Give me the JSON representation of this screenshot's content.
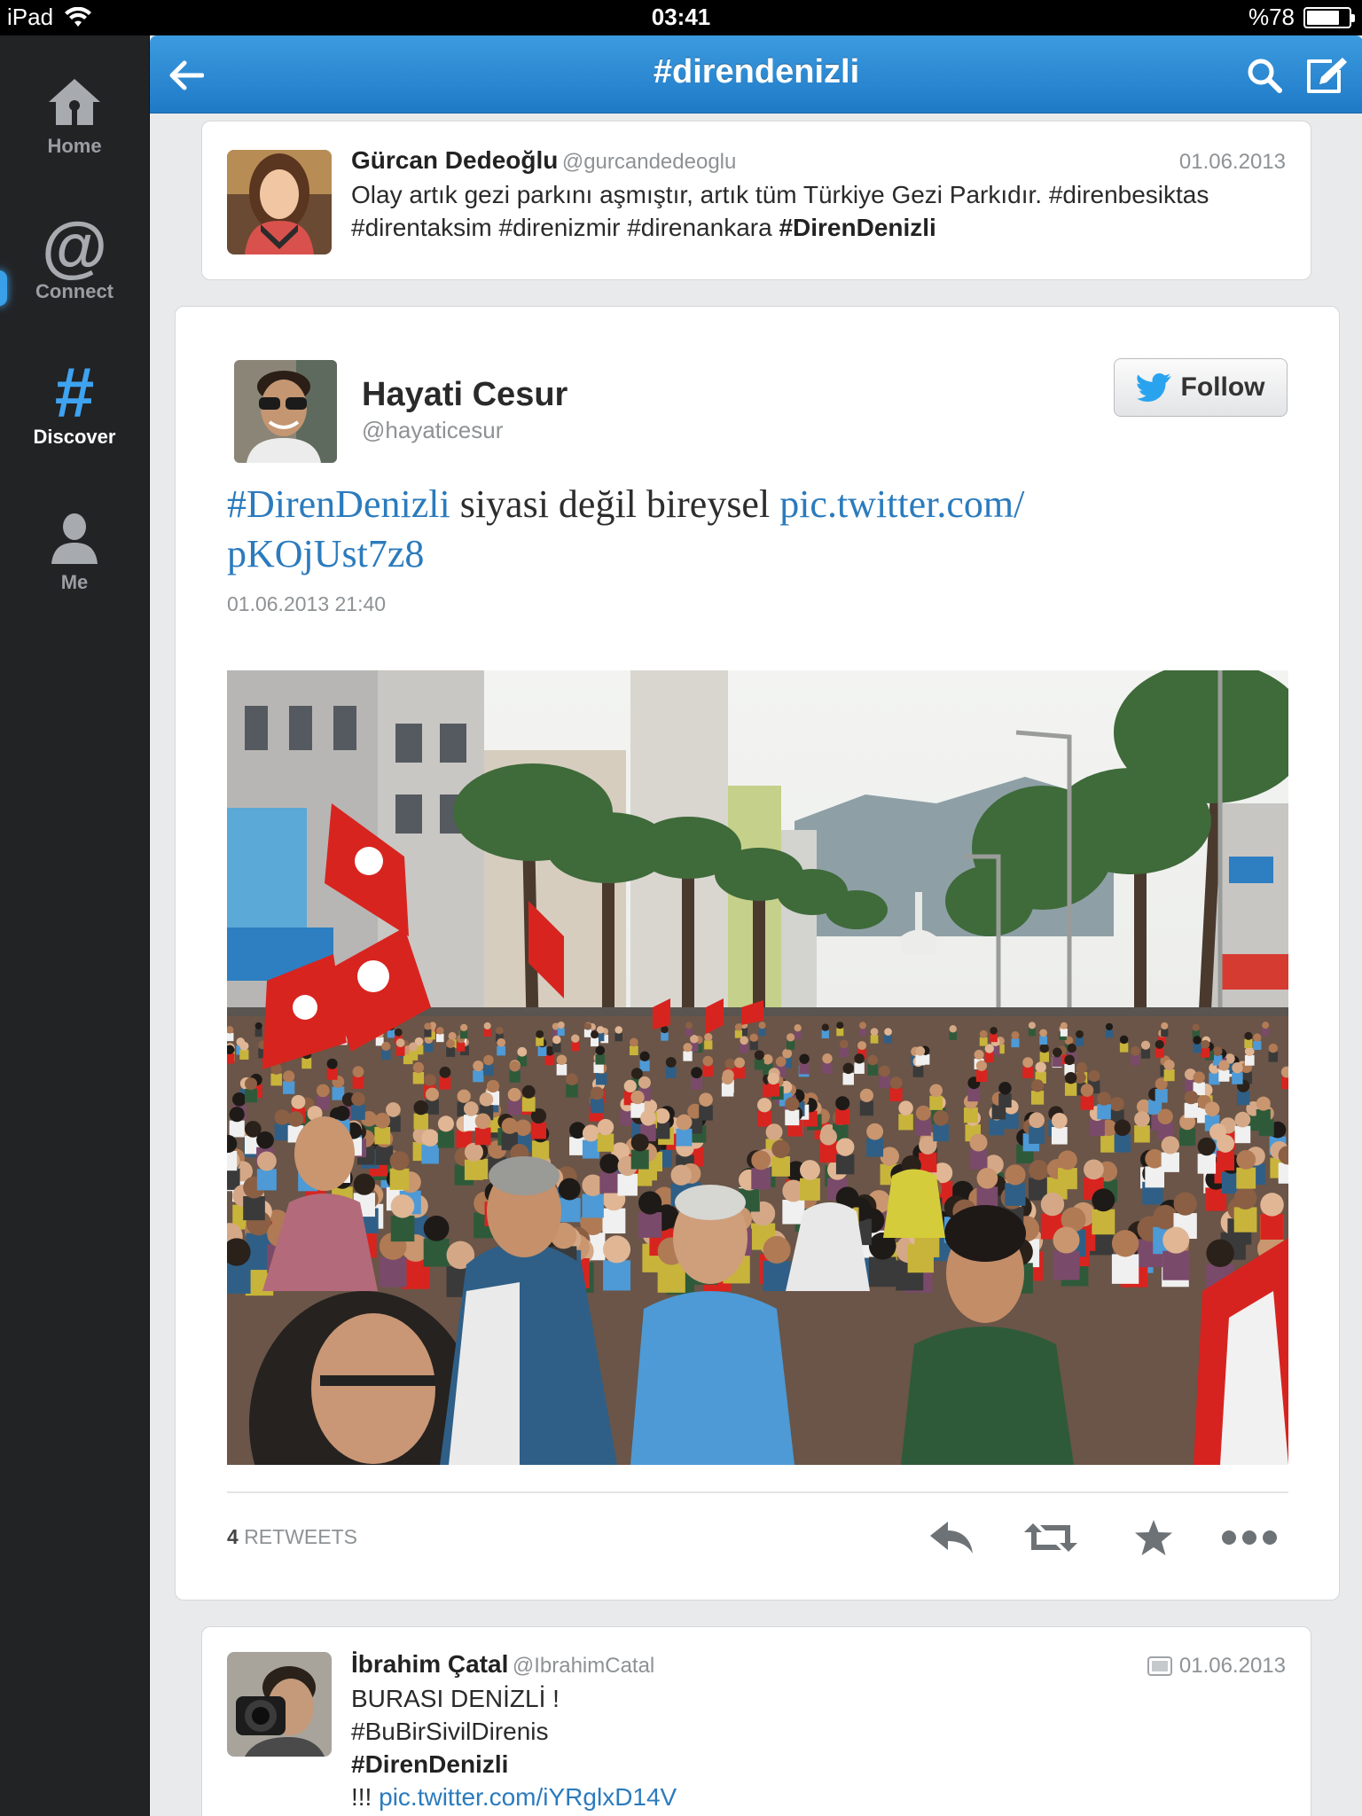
{
  "status_bar": {
    "device": "iPad",
    "time": "03:41",
    "battery": "%78",
    "battery_level": 0.78
  },
  "sidebar": {
    "items": [
      {
        "label": "Home",
        "icon": "home-icon"
      },
      {
        "label": "Connect",
        "icon": "at-icon"
      },
      {
        "label": "Discover",
        "icon": "hash-icon",
        "active": true
      },
      {
        "label": "Me",
        "icon": "person-icon"
      }
    ]
  },
  "header": {
    "title": "#direndenizli"
  },
  "tweets": {
    "first": {
      "name": "Gürcan Dedeoğlu",
      "handle": "@gurcandedeoglu",
      "date": "01.06.2013",
      "text_line1": "Olay artık gezi parkını aşmıştır, artık tüm Türkiye Gezi Parkıdır. #direnbesiktas",
      "text_line2_plain": "#direntaksim #direnizmir #direnankara ",
      "text_line2_bold": "#DirenDenizli"
    },
    "featured": {
      "name": "Hayati Cesur",
      "handle": "@hayaticesur",
      "follow_label": "Follow",
      "hashtag": "#DirenDenizli",
      "text": " siyasi değil bireysel ",
      "link_line1": "pic.twitter.com/",
      "link_line2": "pKOjUst7z8",
      "timestamp": "01.06.2013 21:40",
      "retweet_count": "4",
      "retweet_label": "RETWEETS"
    },
    "third": {
      "name": "İbrahim Çatal",
      "handle": "@IbrahimCatal",
      "date": "01.06.2013",
      "line1": "BURASI DENİZLİ !",
      "line2": "#BuBirSivilDirenis",
      "line3": "#DirenDenizli",
      "line4_prefix": "!!! ",
      "line4_link": "pic.twitter.com/iYRglxD14V"
    }
  },
  "colors": {
    "accent": "#2b7bbd",
    "header": "#2a88d6",
    "sidebar": "#222325",
    "background": "#e9eaeb"
  }
}
